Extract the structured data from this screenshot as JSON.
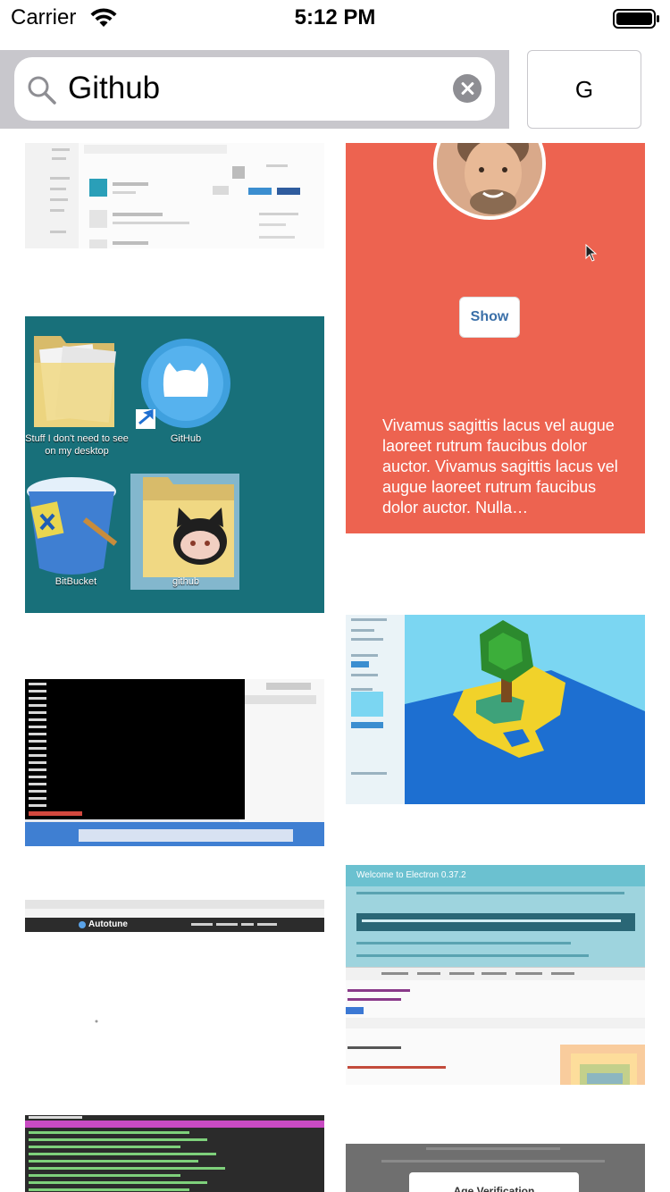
{
  "status_bar": {
    "carrier": "Carrier",
    "time": "5:12 PM",
    "icons": [
      "wifi-icon",
      "battery-icon"
    ]
  },
  "search": {
    "value": "Github",
    "icon": "search-icon",
    "clear_icon": "clear-icon",
    "button_label": "G"
  },
  "results": {
    "card": {
      "show_label": "Show",
      "body_text": "Vivamus sagittis lacus vel augue laoreet rutrum faucibus dolor auctor. Vivamus sagittis lacus vel augue laoreet rutrum faucibus dolor auctor. Nulla…"
    },
    "desktop": {
      "folder_label": "Stuff I don't need to see on my desktop",
      "github_label": "GitHub",
      "bitbucket_label": "BitBucket",
      "github_folder_label": "github"
    },
    "electron": {
      "header": "Welcome to Electron 0.37.2"
    },
    "autotune": {
      "brand": "Autotune"
    },
    "age_verification": {
      "title": "Age Verification"
    }
  },
  "colors": {
    "search_bar_bg": "#c8c7cc",
    "card_orange": "#ed6350",
    "desktop_teal": "#1a6e76",
    "voxel_sky": "#7bd6f2",
    "electron_header": "#6bc1d0"
  }
}
